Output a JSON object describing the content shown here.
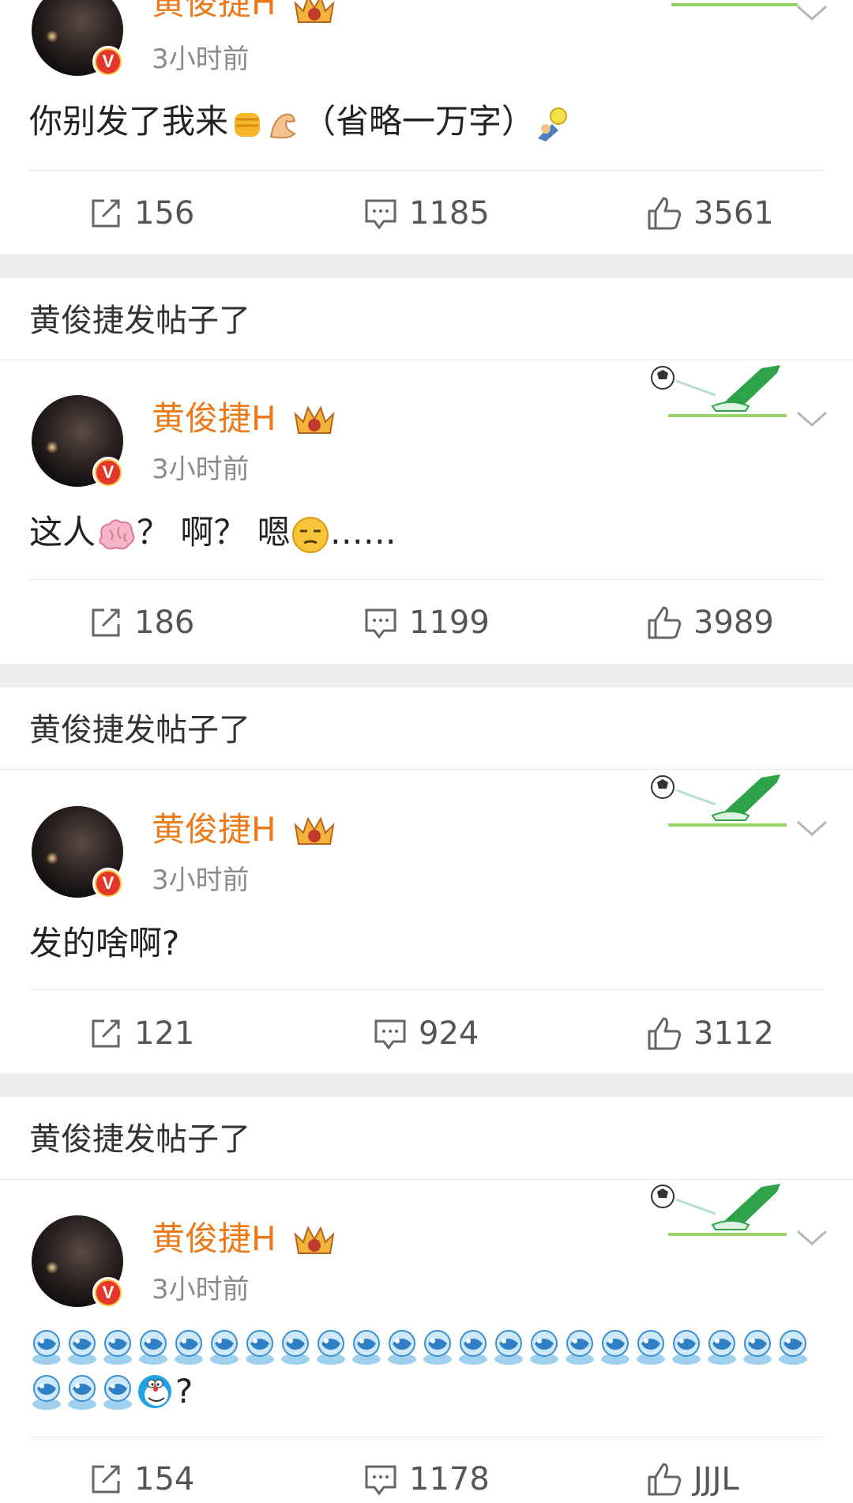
{
  "section_title": "黄俊捷发帖子了",
  "posts": [
    {
      "username": "黄俊捷H",
      "time": "3小时前",
      "text_before": "你别发了我来",
      "text_middle": "（省略一万字）",
      "text_after": "",
      "reposts": "156",
      "comments": "1185",
      "likes": "3561"
    },
    {
      "username": "黄俊捷H",
      "time": "3小时前",
      "text_a": "这人",
      "text_b": "？ 啊？ 嗯",
      "text_c": "……",
      "reposts": "186",
      "comments": "1199",
      "likes": "3989"
    },
    {
      "username": "黄俊捷H",
      "time": "3小时前",
      "text": "发的啥啊?",
      "reposts": "121",
      "comments": "924",
      "likes": "3112"
    },
    {
      "username": "黄俊捷H",
      "time": "3小时前",
      "text_end": "?",
      "reposts": "154",
      "comments": "1178",
      "likes": "JJJL"
    }
  ],
  "icons": {
    "repost": "repost-icon",
    "comment": "comment-icon",
    "like": "thumbs-up-icon",
    "more": "chevron-down-icon",
    "verified": "verified-badge-icon",
    "crown": "crown-badge-icon",
    "card_decor": "soccer-kick-decoration"
  },
  "colors": {
    "username": "#eb7a1a",
    "separator": "#ececec",
    "verified_red": "#e3372c",
    "verified_gold": "#f6c33a"
  }
}
